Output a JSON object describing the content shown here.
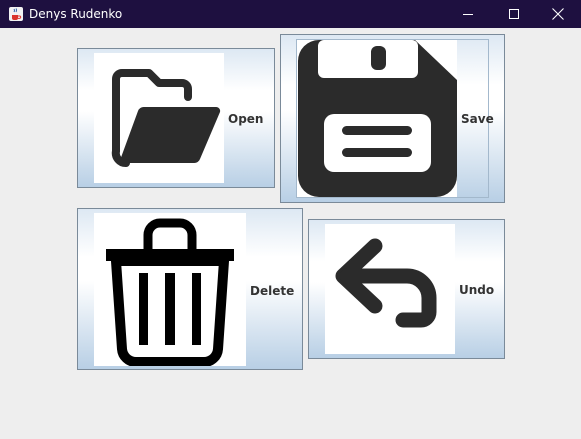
{
  "window": {
    "title": "Denys Rudenko",
    "icon": "java-cup-icon",
    "controls": [
      "minimize-icon",
      "maximize-icon",
      "close-icon"
    ]
  },
  "buttons": {
    "open": {
      "label": "Open",
      "icon": "folder-open-icon"
    },
    "save": {
      "label": "Save",
      "icon": "floppy-disk-icon",
      "focused": true
    },
    "delete": {
      "label": "Delete",
      "icon": "trash-can-icon"
    },
    "undo": {
      "label": "Undo",
      "icon": "undo-arrow-icon"
    }
  },
  "colors": {
    "titlebar": "#1e1040",
    "background": "#eeeeee",
    "icon_fill": "#2b2b2b",
    "label": "#333333"
  }
}
